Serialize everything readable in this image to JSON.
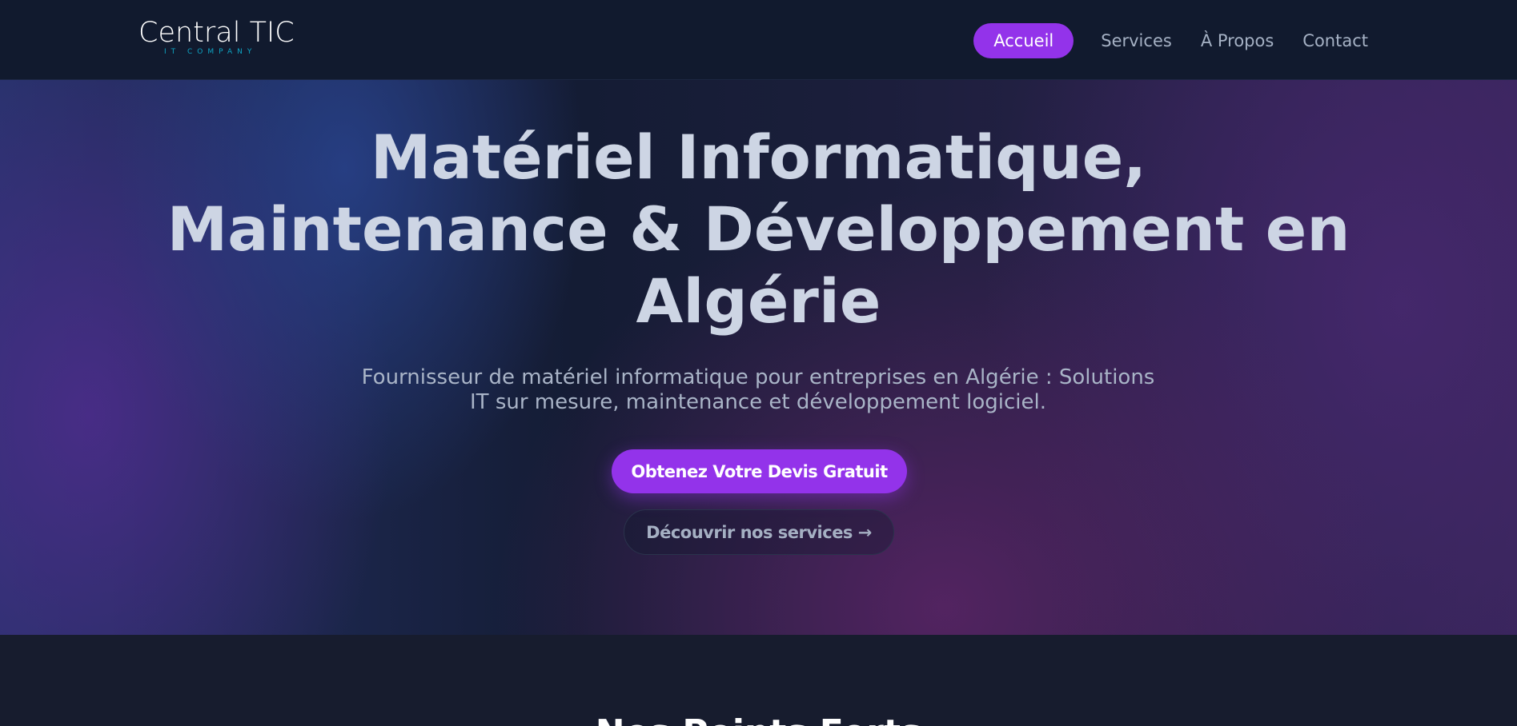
{
  "header": {
    "logo": {
      "name": "Central TIC",
      "tagline": "IT COMPANY"
    },
    "nav": [
      {
        "label": "Accueil",
        "active": true
      },
      {
        "label": "Services",
        "active": false
      },
      {
        "label": "À Propos",
        "active": false
      },
      {
        "label": "Contact",
        "active": false
      }
    ]
  },
  "hero": {
    "title_lines": [
      "Matériel Informatique,",
      "Maintenance & Développement en",
      "Algérie"
    ],
    "subtitle": "Fournisseur de matériel informatique pour entreprises en Algérie : Solutions IT sur mesure, maintenance et développement logiciel.",
    "primary_cta": "Obtenez Votre Devis Gratuit",
    "secondary_cta": "Découvrir nos services →"
  },
  "next_section": {
    "title": "Nos Points Forts"
  },
  "colors": {
    "accent": "#9333ea",
    "nav_background": "#111a2e",
    "page_background": "#0f172a",
    "logo_tagline": "#0ea5c4"
  }
}
